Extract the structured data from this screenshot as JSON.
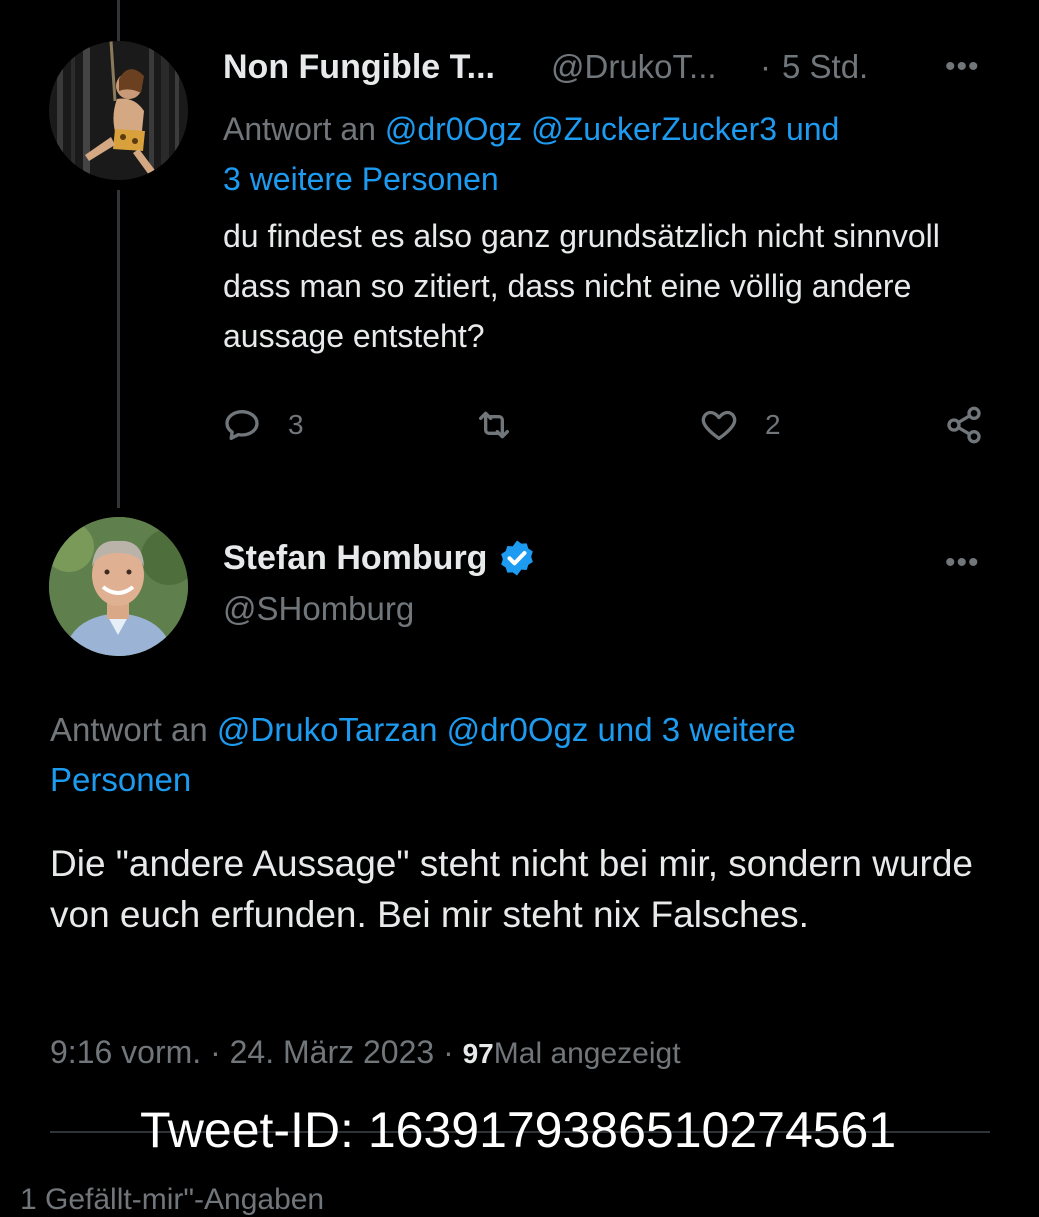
{
  "reply_tweet": {
    "display_name": "Non Fungible T...",
    "handle": "@DrukoT...",
    "separator": "·",
    "time": "5 Std.",
    "more_label": "•••",
    "reply_prefix": "Antwort an",
    "reply_mentions_line1": "@dr0Ogz @ZuckerZucker3 und",
    "reply_mentions_line2": "3 weitere Personen",
    "text": "du findest es also ganz grundsätzlich nicht sinnvoll dass man so zitiert, dass nicht eine völlig andere aussage entsteht?",
    "reply_count": "3",
    "like_count": "2",
    "icons": [
      "reply-icon",
      "retweet-icon",
      "like-icon",
      "share-icon"
    ]
  },
  "main_tweet": {
    "display_name": "Stefan Homburg",
    "handle": "@SHomburg",
    "more_label": "•••",
    "verified": true,
    "reply_prefix": "Antwort an",
    "reply_mentions_line1": "@DrukoTarzan @dr0Ogz und 3 weitere",
    "reply_mentions_line2": "Personen",
    "text": "Die \"andere Aussage\" steht nicht bei mir, sondern wurde von euch erfunden. Bei mir steht nix Falsches.",
    "time": "9:16 vorm.",
    "date": "24. März 2023",
    "separator": "·",
    "views_count": "97",
    "views_label": "Mal angezeigt"
  },
  "overlay_text": "Tweet-ID: 1639179386510274561",
  "cut_off_text": "1 Gefällt-mir\"-Angaben",
  "colors": {
    "background": "#000000",
    "text": "#e7e9ea",
    "muted": "#71767b",
    "accent": "#1d9bf0",
    "divider": "#2f3336"
  }
}
